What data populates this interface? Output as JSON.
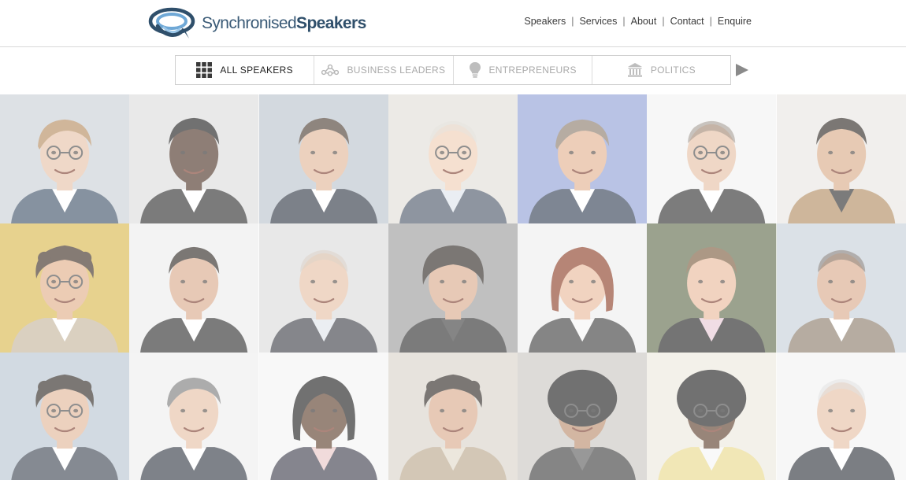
{
  "brand": {
    "name_light": "Synchronised",
    "name_bold": "Speakers",
    "logo_color": "#2f4f6b"
  },
  "topnav": {
    "items": [
      {
        "label": "Speakers"
      },
      {
        "label": "Services"
      },
      {
        "label": "About"
      },
      {
        "label": "Contact"
      },
      {
        "label": "Enquire"
      }
    ],
    "separator": "|"
  },
  "categories": {
    "items": [
      {
        "label": "ALL SPEAKERS",
        "icon": "grid-icon",
        "active": true
      },
      {
        "label": "BUSINESS LEADERS",
        "icon": "network-icon",
        "active": false
      },
      {
        "label": "ENTREPRENEURS",
        "icon": "lightbulb-icon",
        "active": false
      },
      {
        "label": "POLITICS",
        "icon": "government-building-icon",
        "active": false
      }
    ],
    "next_icon": "play-arrow-icon"
  },
  "speakers": {
    "tiles": [
      {
        "bg": "#c9cfd6",
        "skin": "#e6c1a6",
        "hair": "#b48a5c",
        "suit": "#3d4f66",
        "shirt": "#ffffff",
        "hair_style": "side",
        "glasses": true
      },
      {
        "bg": "#dcdcdc",
        "skin": "#4a2f22",
        "hair": "#1a1a1a",
        "suit": "#2a2a2a",
        "shirt": "#ffffff",
        "hair_style": "short",
        "glasses": false
      },
      {
        "bg": "#b9c2cb",
        "skin": "#e0b597",
        "hair": "#4a3a30",
        "suit": "#2c3442",
        "shirt": "#ffffff",
        "hair_style": "short",
        "glasses": false
      },
      {
        "bg": "#e1ddd7",
        "skin": "#efcdb3",
        "hair": "#d9d4cc",
        "suit": "#4a5566",
        "shirt": "#dde4ec",
        "hair_style": "bald",
        "glasses": true
      },
      {
        "bg": "#8e9fd6",
        "skin": "#e2b08e",
        "hair": "#8a7a6a",
        "suit": "#2f3c52",
        "shirt": "#ffffff",
        "hair_style": "side",
        "glasses": false
      },
      {
        "bg": "#f2f2f2",
        "skin": "#e6bfa3",
        "hair": "#6a5a4a",
        "suit": "#2d2d2d",
        "shirt": "#ffffff",
        "hair_style": "bald",
        "glasses": true
      },
      {
        "bg": "#e8e6e3",
        "skin": "#d8aa86",
        "hair": "#2a2520",
        "suit": "#b08a5e",
        "shirt": "#2a2a2a",
        "hair_style": "short",
        "glasses": false
      },
      {
        "bg": "#d8b64a",
        "skin": "#e0ad86",
        "hair": "#3a2a20",
        "suit": "#c4b49a",
        "shirt": "#ffffff",
        "hair_style": "curly",
        "glasses": true
      },
      {
        "bg": "#ececec",
        "skin": "#d9a98a",
        "hair": "#2a2520",
        "suit": "#2b2b2b",
        "shirt": "#ffffff",
        "hair_style": "short",
        "glasses": false
      },
      {
        "bg": "#dadada",
        "skin": "#e6bfa3",
        "hair": "#c9b8a8",
        "suit": "#3a3d44",
        "shirt": "#dfe4ea",
        "hair_style": "bald",
        "glasses": false
      },
      {
        "bg": "#9a9a9a",
        "skin": "#d8a98a",
        "hair": "#2a2520",
        "suit": "#2a2a2a",
        "shirt": "#3a3a3a",
        "hair_style": "mop",
        "glasses": false
      },
      {
        "bg": "#ededed",
        "skin": "#e8b899",
        "hair": "#8a3a22",
        "suit": "#3a3a3a",
        "shirt": "#f5f5f5",
        "hair_style": "bob",
        "glasses": false
      },
      {
        "bg": "#5e6a4a",
        "skin": "#e8b899",
        "hair": "#7a5a3a",
        "suit": "#1f1f1f",
        "shirt": "#e7c9d6",
        "hair_style": "short",
        "glasses": false
      },
      {
        "bg": "#c5cfd8",
        "skin": "#d8a98a",
        "hair": "#4a3a30",
        "suit": "#8a7a68",
        "shirt": "#ffffff",
        "hair_style": "bald",
        "glasses": false
      },
      {
        "bg": "#b7c3d0",
        "skin": "#e0b597",
        "hair": "#2a2520",
        "suit": "#3a4350",
        "shirt": "#ffffff",
        "hair_style": "curly",
        "glasses": true
      },
      {
        "bg": "#eeeeee",
        "skin": "#e6bfa3",
        "hair": "#7a7a7a",
        "suit": "#2f3642",
        "shirt": "#ffffff",
        "hair_style": "side",
        "glasses": false
      },
      {
        "bg": "#f4f4f4",
        "skin": "#5a3a28",
        "hair": "#1a1a1a",
        "suit": "#3a3a4a",
        "shirt": "#e9c6c6",
        "hair_style": "bob",
        "glasses": false
      },
      {
        "bg": "#d8d2c8",
        "skin": "#d8a98a",
        "hair": "#2a2520",
        "suit": "#b8a58a",
        "shirt": "#e0d8c8",
        "hair_style": "curly",
        "glasses": false
      },
      {
        "bg": "#c9c6c0",
        "skin": "#b88a6a",
        "hair": "#1a1a1a",
        "suit": "#3a3a3a",
        "shirt": "#5a5a5a",
        "hair_style": "afro",
        "glasses": true
      },
      {
        "bg": "#ece8de",
        "skin": "#5a3a28",
        "hair": "#1a1a1a",
        "suit": "#e8d88a",
        "shirt": "#f5f5f5",
        "hair_style": "afro",
        "glasses": true
      },
      {
        "bg": "#f3f3f3",
        "skin": "#e6bfa3",
        "hair": "#cfcfcf",
        "suit": "#2b2f38",
        "shirt": "#ffffff",
        "hair_style": "bald",
        "glasses": false
      }
    ]
  }
}
